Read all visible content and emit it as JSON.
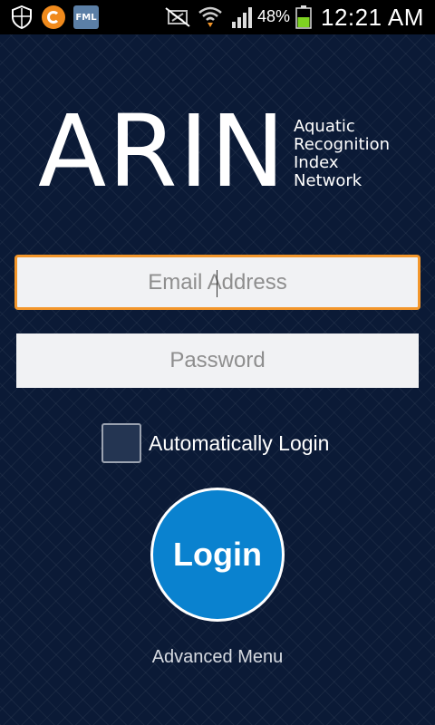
{
  "status_bar": {
    "app_badge": "FML",
    "battery_percent": "48%",
    "time": "12:21 AM",
    "icons": [
      "shield-icon",
      "circle-app-icon",
      "fml-app-icon",
      "mute-icon",
      "wifi-icon",
      "signal-icon",
      "battery-icon"
    ]
  },
  "logo": {
    "title": "ARIN",
    "subtitle_lines": [
      "Aquatic",
      "Recognition",
      "Index",
      "Network"
    ]
  },
  "form": {
    "email_placeholder": "Email Address",
    "password_placeholder": "Password",
    "auto_login_label": "Automatically Login",
    "auto_login_checked": false,
    "login_label": "Login",
    "advanced_label": "Advanced Menu"
  },
  "colors": {
    "background": "#0b1a36",
    "focus_border": "#f3962a",
    "login_button": "#0a82cf"
  }
}
